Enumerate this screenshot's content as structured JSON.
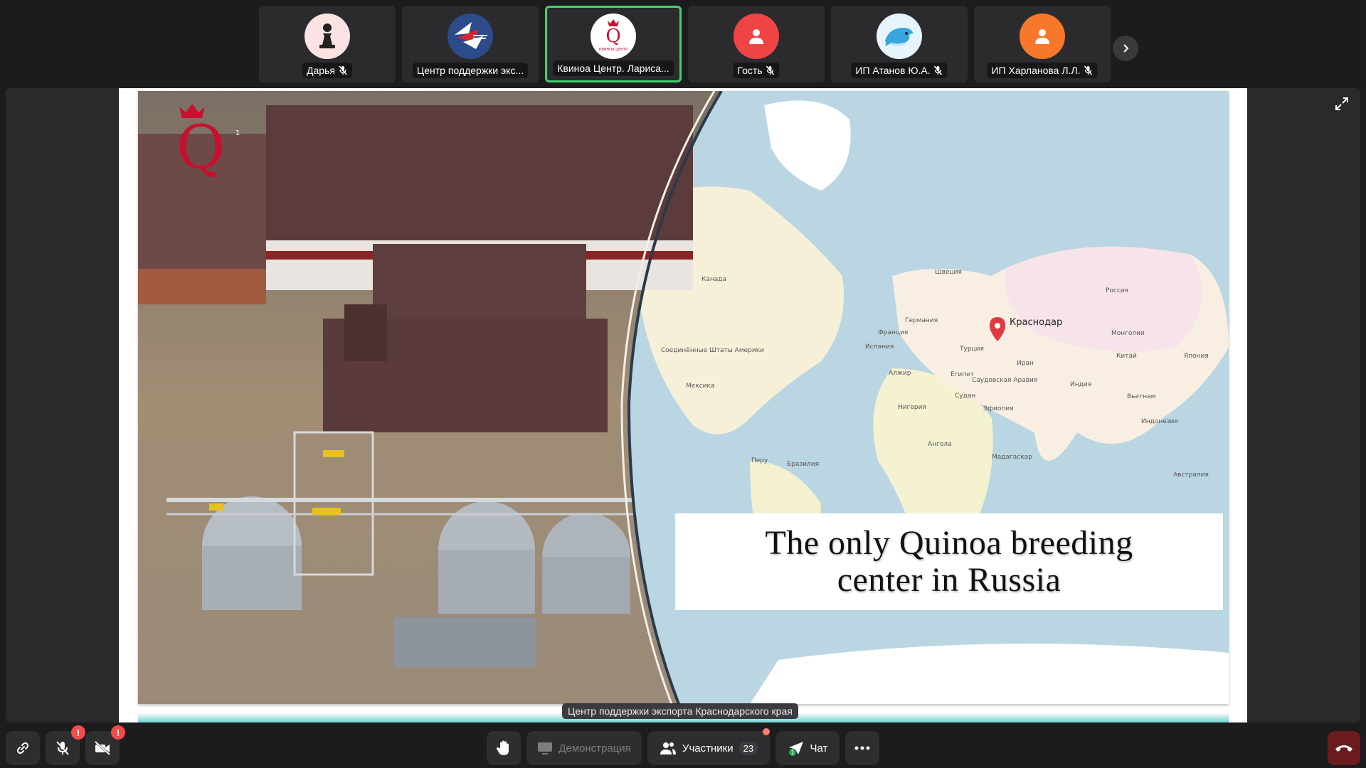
{
  "participants": [
    {
      "name": "Дарья",
      "avatar": "chess-pawn-icon",
      "muted": true,
      "active": false
    },
    {
      "name": "Центр поддержки экс...",
      "avatar": "export-center-logo",
      "muted": false,
      "active": false
    },
    {
      "name": "Квиноа Центр. Лариса...",
      "avatar": "quinoa-center-logo",
      "muted": false,
      "active": true
    },
    {
      "name": "Гость",
      "avatar": "user-icon",
      "muted": true,
      "active": false
    },
    {
      "name": "ИП Атанов Ю.А.",
      "avatar": "dolphin-avatar",
      "muted": true,
      "active": false
    },
    {
      "name": "ИП Харланова Л.Л.",
      "avatar": "user-icon",
      "muted": true,
      "active": false
    }
  ],
  "avatar_logo_text": "КВИНОА ЦЕНТР",
  "slide": {
    "title_line1": "The only Quinoa breeding",
    "title_line2": "center in Russia",
    "pin_label": "Краснодар",
    "map_labels": {
      "canada": "Канада",
      "usa": "Соединённые Штаты Америки",
      "mexico": "Мексика",
      "peru": "Перу",
      "brazil": "Бразилия",
      "sweden": "Швеция",
      "germany": "Германия",
      "france": "Франция",
      "spain": "Испания",
      "turkey": "Турция",
      "algeria": "Алжир",
      "egypt": "Египет",
      "saudi": "Саудовская Аравия",
      "iran": "Иран",
      "sudan": "Судан",
      "nigeria": "Нигерия",
      "ethiopia": "Эфиопия",
      "angola": "Ангола",
      "madagascar": "Мадагаскар",
      "india": "Индия",
      "russia": "Россия",
      "mongolia": "Монголия",
      "china": "Китай",
      "japan": "Япония",
      "vietnam": "Вьетнам",
      "indonesia": "Индонезия",
      "australia": "Австралия"
    }
  },
  "presenter_label": "Центр поддержки экспорта Краснодарского края",
  "toolbar": {
    "error_badge": "!",
    "demo_label": "Демонстрация",
    "participants_label": "Участники",
    "participants_count": "23",
    "chat_label": "Чат",
    "chat_badge": "1"
  },
  "colors": {
    "active_border": "#3fd46b",
    "guest_avatar": "#ef4444",
    "user_avatar": "#f7772b",
    "error_badge": "#f24b4b",
    "hangup": "#6b1b1b"
  }
}
